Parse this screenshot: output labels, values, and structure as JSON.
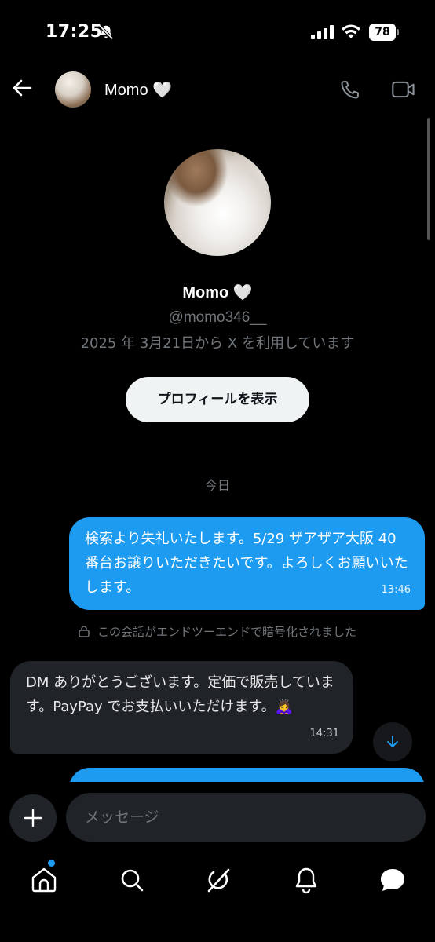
{
  "status_bar": {
    "time": "17:25",
    "battery": "78"
  },
  "header": {
    "name": "Momo 🤍"
  },
  "profile": {
    "name": "Momo 🤍",
    "handle": "@momo346__",
    "joined": "2025 年 3月21日から X を利用しています",
    "view_profile_label": "プロフィールを表示"
  },
  "conversation": {
    "date_divider": "今日",
    "encryption_note": "この会話がエンドツーエンドで暗号化されました",
    "messages": [
      {
        "direction": "outgoing",
        "text": "検索より失礼いたします。5/29 ザアザア大阪 40 番台お譲りいただきたいです。よろしくお願いいたします。",
        "time": "13:46"
      },
      {
        "direction": "incoming",
        "text": "DM ありがとうございます。定価で販売しています。PayPay でお支払いいただけます。🙇‍♀️",
        "time": "14:31"
      },
      {
        "direction": "outgoing",
        "text": "",
        "time": ""
      }
    ]
  },
  "composer": {
    "placeholder": "メッセージ"
  },
  "icons": {
    "back": "arrow-left-icon",
    "call": "phone-icon",
    "video": "video-camera-icon",
    "add": "plus-icon",
    "scroll_down": "arrow-down-icon",
    "nav": [
      "home-icon",
      "search-icon",
      "grok-icon",
      "bell-icon",
      "messages-icon"
    ]
  },
  "colors": {
    "accent": "#1d9bf0",
    "background": "#000000",
    "incoming_bubble": "#202327",
    "muted_text": "#71767b"
  }
}
